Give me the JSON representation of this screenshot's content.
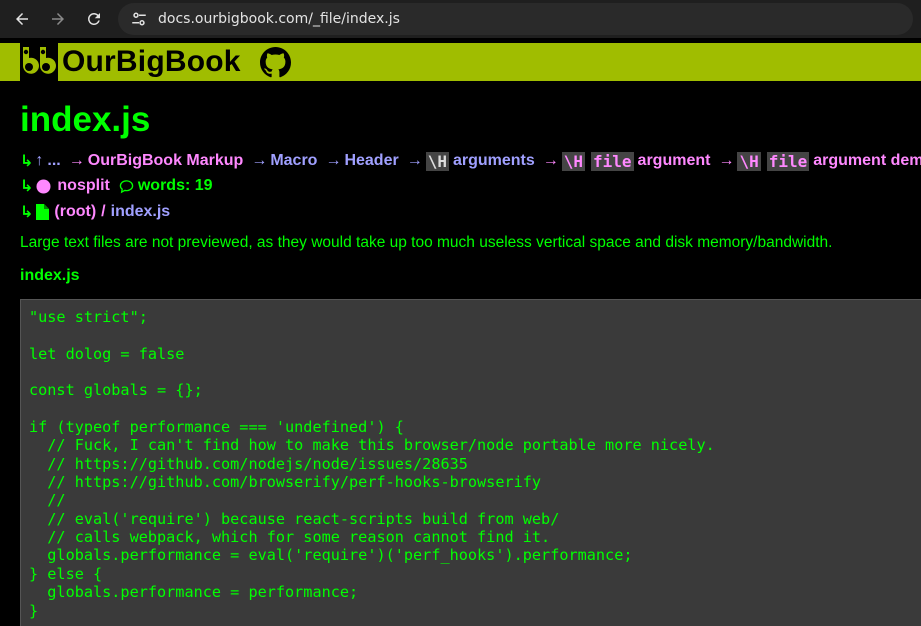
{
  "browser": {
    "url": "docs.ourbigbook.com/_file/index.js"
  },
  "site": {
    "name": "OurBigBook"
  },
  "page": {
    "title": "index.js",
    "breadcrumb": {
      "up": "...",
      "items": [
        "OurBigBook Markup",
        "Macro",
        "Header"
      ],
      "arg1_code": "\\H",
      "arg1_text": "arguments",
      "arg2_code": "\\H",
      "arg2_code2": "file",
      "arg2_text": "argument",
      "arg3_code": "\\H",
      "arg3_code2": "file",
      "arg3_text": "argument demo"
    },
    "meta": {
      "nosplit": "nosplit",
      "words": "words: 19"
    },
    "path": {
      "root": "(root)",
      "sep": "/",
      "file": "index.js"
    },
    "note": "Large text files are not previewed, as they would take up too much useless vertical space and disk memory/bandwidth.",
    "file_label": "index.js",
    "code": "\"use strict\";\n\nlet dolog = false\n\nconst globals = {};\n\nif (typeof performance === 'undefined') {\n  // Fuck, I can't find how to make this browser/node portable more nicely.\n  // https://github.com/nodejs/node/issues/28635\n  // https://github.com/browserify/perf-hooks-browserify\n  //\n  // eval('require') because react-scripts build from web/\n  // calls webpack, which for some reason cannot find it.\n  globals.performance = eval('require')('perf_hooks').performance;\n} else {\n  globals.performance = performance;\n}"
  },
  "colors": {
    "header_bg": "#a0bd00",
    "green": "#00ff00",
    "link_blue": "#a0a0ff",
    "link_pink": "#ff88ff"
  }
}
